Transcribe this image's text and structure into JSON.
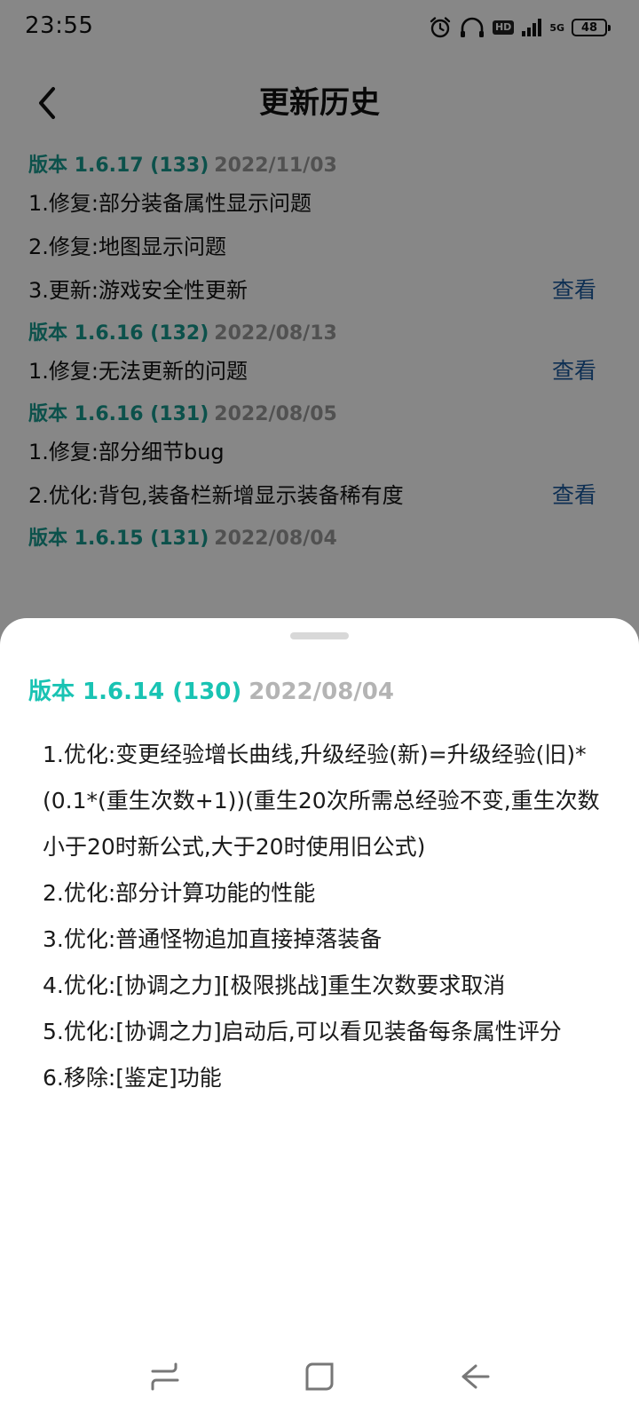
{
  "status": {
    "time": "23:55",
    "hd": "HD",
    "network": "5G",
    "battery": "48"
  },
  "header": {
    "title": "更新历史"
  },
  "history": [
    {
      "version": "版本 1.6.17 (133)",
      "date": "2022/11/03",
      "changes": [
        "1.修复:部分装备属性显示问题",
        "2.修复:地图显示问题",
        "3.更新:游戏安全性更新"
      ]
    },
    {
      "version": "版本 1.6.16 (132)",
      "date": "2022/08/13",
      "changes": [
        "1.修复:无法更新的问题"
      ]
    },
    {
      "version": "版本 1.6.16 (131)",
      "date": "2022/08/05",
      "changes": [
        "1.修复:部分细节bug",
        "2.优化:背包,装备栏新增显示装备稀有度"
      ]
    },
    {
      "version": "版本 1.6.15 (131)",
      "date": "2022/08/04",
      "changes": []
    }
  ],
  "view_label": "查看",
  "sheet": {
    "version": "版本 1.6.14 (130)",
    "date": "2022/08/04",
    "changes": [
      "1.优化:变更经验增长曲线,升级经验(新)=升级经验(旧)*(0.1*(重生次数+1))(重生20次所需总经验不变,重生次数小于20时新公式,大于20时使用旧公式)",
      "2.优化:部分计算功能的性能",
      "3.优化:普通怪物追加直接掉落装备",
      "4.优化:[协调之力][极限挑战]重生次数要求取消",
      "5.优化:[协调之力]启动后,可以看见装备每条属性评分",
      "6.移除:[鉴定]功能"
    ]
  },
  "colors": {
    "version_teal": "#179a8f",
    "sheet_teal": "#19c3b3",
    "date_gray": "#9a9a9a",
    "link_blue": "#1b5a9e"
  }
}
